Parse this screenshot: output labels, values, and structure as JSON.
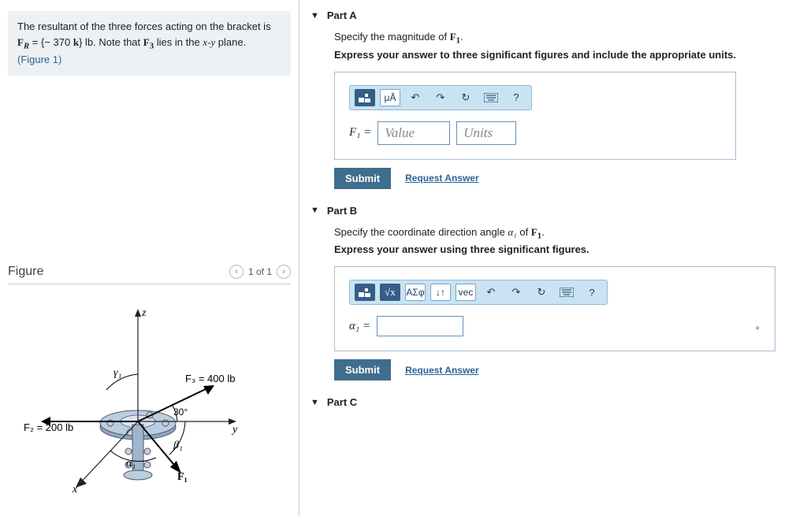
{
  "intro": {
    "line1_pre": "The resultant of the three forces acting on the bracket is ",
    "fr_lhs": "F",
    "fr_sub": "R",
    "fr_eq": " = {− 370 ",
    "fr_k": "k",
    "fr_unit": "} lb",
    "line1_post": ". Note that ",
    "f3_lhs": "F",
    "f3_sub": "3",
    "lies": " lies in the ",
    "xy": "x-y",
    "plane": " plane. ",
    "fig_link": "(Figure 1)"
  },
  "figure": {
    "heading": "Figure",
    "pager": "1 of 1",
    "labels": {
      "z": "z",
      "y": "y",
      "x": "x",
      "gamma1": "γ₁",
      "beta1": "β₁",
      "alpha1": "α₁",
      "angle30": "30°",
      "F1": "F₁",
      "F2": "F₂ = 200 lb",
      "F3": "F₃ = 400 lb"
    }
  },
  "partA": {
    "title": "Part A",
    "prompt_pre": "Specify the magnitude of ",
    "F1_lhs": "F",
    "F1_sub": "1",
    "prompt_post": ".",
    "instr": "Express your answer to three significant figures and include the appropriate units.",
    "lhs": "F₁ =",
    "value_ph": "Value",
    "units_ph": "Units",
    "submit": "Submit",
    "request": "Request Answer",
    "tool_muA": "μÅ",
    "tool_q": "?"
  },
  "partB": {
    "title": "Part B",
    "prompt_pre": "Specify the coordinate direction angle ",
    "a1": "α₁",
    "prompt_mid": " of ",
    "F1_lhs": "F",
    "F1_sub": "1",
    "prompt_post": ".",
    "instr": "Express your answer using three significant figures.",
    "lhs": "α₁ =",
    "submit": "Submit",
    "request": "Request Answer",
    "tool_sigma": "ΑΣφ",
    "tool_vec": "vec",
    "tool_q": "?",
    "deg": "∘"
  },
  "partC": {
    "title": "Part C"
  }
}
